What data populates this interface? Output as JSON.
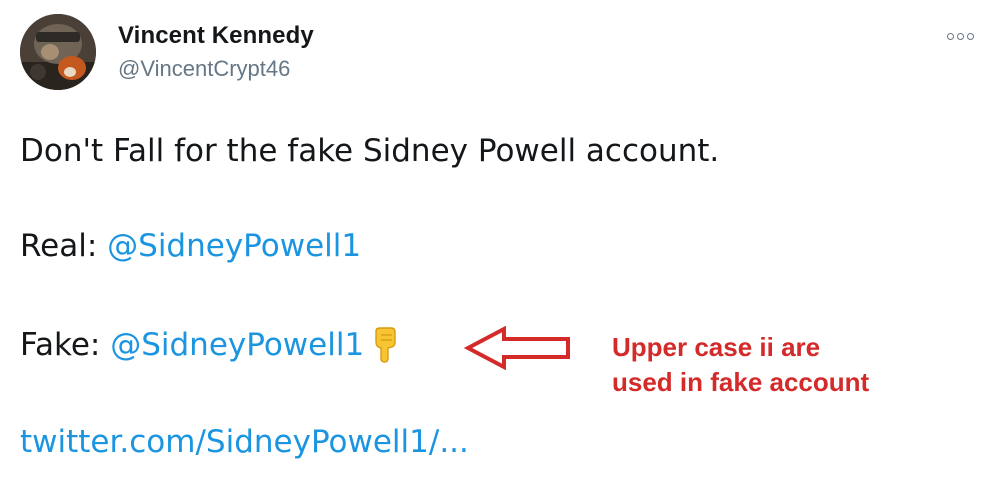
{
  "tweet": {
    "author": {
      "display_name": "Vincent Kennedy",
      "handle": "@VincentCrypt46",
      "avatar_icon": "profile-photo"
    },
    "more_icon": "more-options-icon",
    "text_line_1": "Don't Fall for the fake Sidney Powell account.",
    "real_label": "Real:",
    "real_mention": "@SidneyPowell1",
    "fake_label": "Fake:",
    "fake_mention": "@SidneyPowell1",
    "pointing_emoji": "backhand-index-pointing-down",
    "link_text": "twitter.com/SidneyPowell1/...",
    "link_color": "#1b95e0"
  },
  "annotation": {
    "arrow_icon": "left-arrow-outline",
    "line_1": "Upper case ii are",
    "line_2": "used in fake account",
    "color": "#d42a2a"
  }
}
